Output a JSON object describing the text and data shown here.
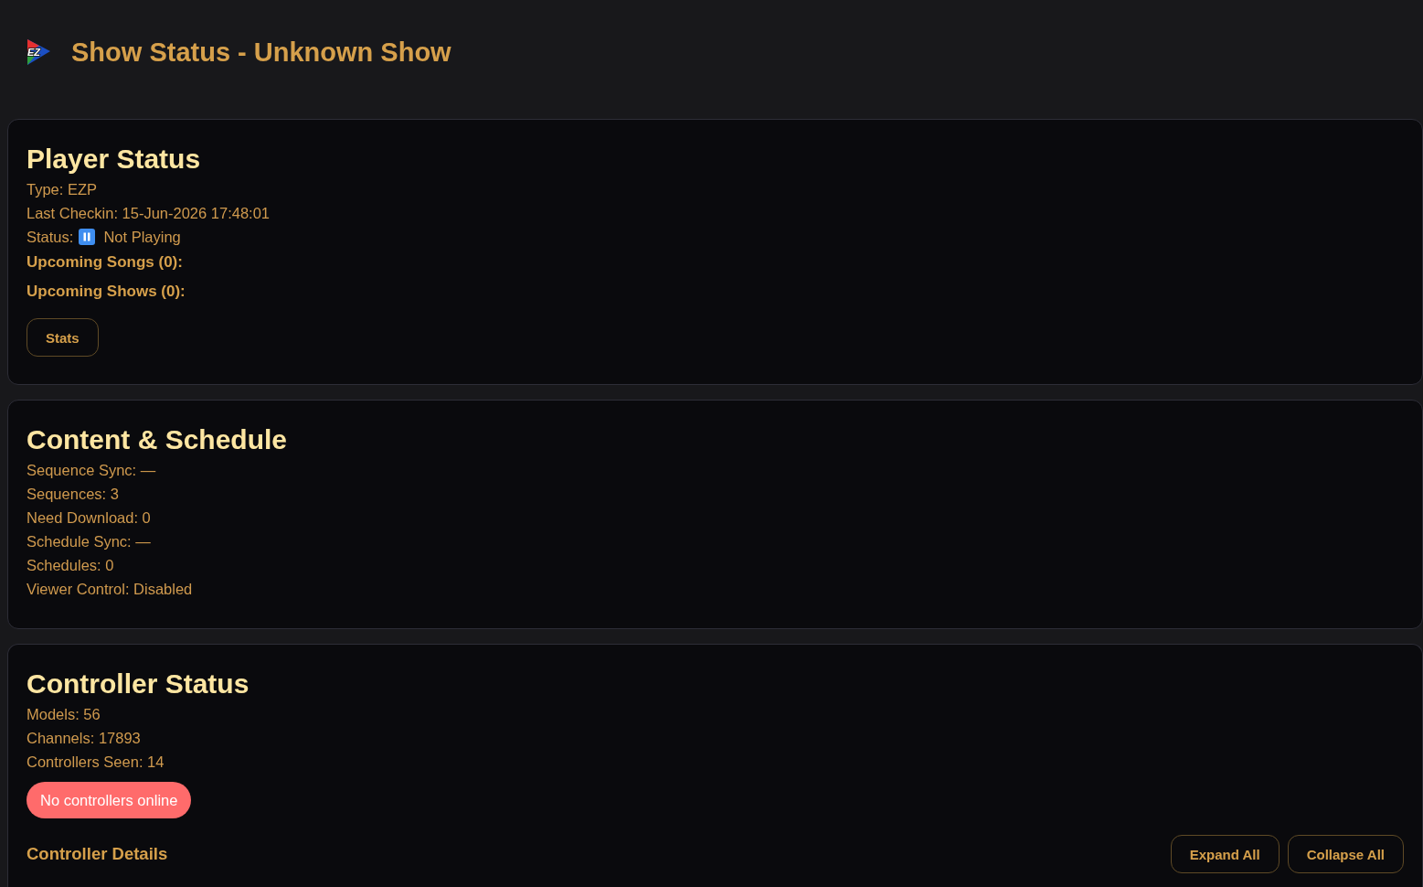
{
  "header": {
    "logo_text": "EZ",
    "title": "Show Status - Unknown Show"
  },
  "sections": [
    {
      "title": "Player Status",
      "items": [
        {
          "kind": "text",
          "text": "Type: EZP"
        },
        {
          "kind": "text",
          "text": "Last Checkin: 15-Jun-2026 17:48:01"
        },
        {
          "kind": "status",
          "label": "Status:",
          "value": "Not Playing",
          "playing": false
        },
        {
          "kind": "subheading",
          "text": "Upcoming Songs (0):"
        },
        {
          "kind": "subheading",
          "text": "Upcoming Shows (0):"
        },
        {
          "kind": "buttons",
          "buttons": [
            {
              "label": "Stats"
            }
          ]
        }
      ]
    },
    {
      "title": "Content & Schedule",
      "items": [
        {
          "kind": "text",
          "text": "Sequence Sync: —"
        },
        {
          "kind": "text",
          "text": "Sequences: 3"
        },
        {
          "kind": "text",
          "text": "Need Download: 0"
        },
        {
          "kind": "text",
          "text": "Schedule Sync: —"
        },
        {
          "kind": "text",
          "text": "Schedules: 0"
        },
        {
          "kind": "text",
          "text": "Viewer Control: Disabled"
        }
      ]
    },
    {
      "title": "Controller Status",
      "items": [
        {
          "kind": "text",
          "text": "Models: 56"
        },
        {
          "kind": "text",
          "text": "Channels: 17893"
        },
        {
          "kind": "text",
          "text": "Controllers Seen: 14"
        },
        {
          "kind": "alert",
          "text": "No controllers online"
        },
        {
          "kind": "details",
          "title": "Controller Details",
          "buttons": [
            {
              "label": "Expand All"
            },
            {
              "label": "Collapse All"
            }
          ]
        }
      ]
    }
  ]
}
